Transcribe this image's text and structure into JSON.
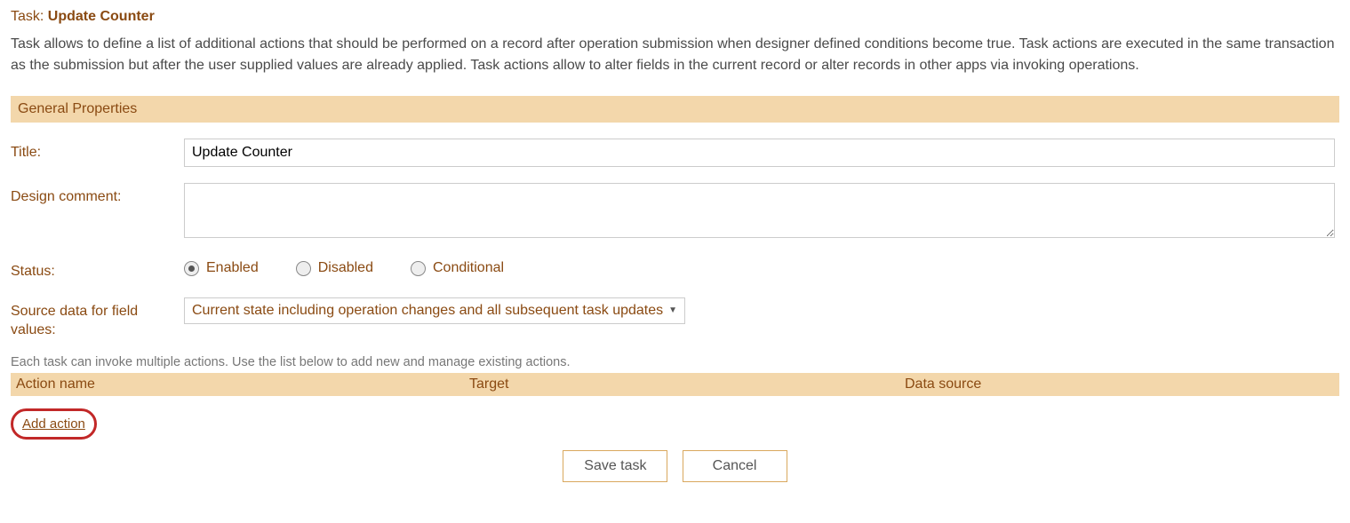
{
  "header": {
    "prefix": "Task: ",
    "task_name": "Update Counter"
  },
  "description": "Task allows to define a list of additional actions that should be performed on a record after operation submission when designer defined conditions become true. Task actions are executed in the same transaction as the submission but after the user supplied values are already applied. Task actions allow to alter fields in the current record or alter records in other apps via invoking operations.",
  "section": {
    "general": "General Properties"
  },
  "labels": {
    "title": "Title:",
    "design_comment": "Design comment:",
    "status": "Status:",
    "source_data": "Source data for field values:"
  },
  "fields": {
    "title_value": "Update Counter",
    "design_comment_value": ""
  },
  "status_options": {
    "enabled": {
      "label": "Enabled",
      "checked": true
    },
    "disabled": {
      "label": "Disabled",
      "checked": false
    },
    "conditional": {
      "label": "Conditional",
      "checked": false
    }
  },
  "source_select": {
    "selected": "Current state including operation changes and all subsequent task updates"
  },
  "actions_hint": "Each task can invoke multiple actions. Use the list below to add new and manage existing actions.",
  "actions_table": {
    "columns": {
      "name": "Action name",
      "target": "Target",
      "source": "Data source"
    }
  },
  "links": {
    "add_action": "Add action"
  },
  "buttons": {
    "save": "Save task",
    "cancel": "Cancel"
  }
}
